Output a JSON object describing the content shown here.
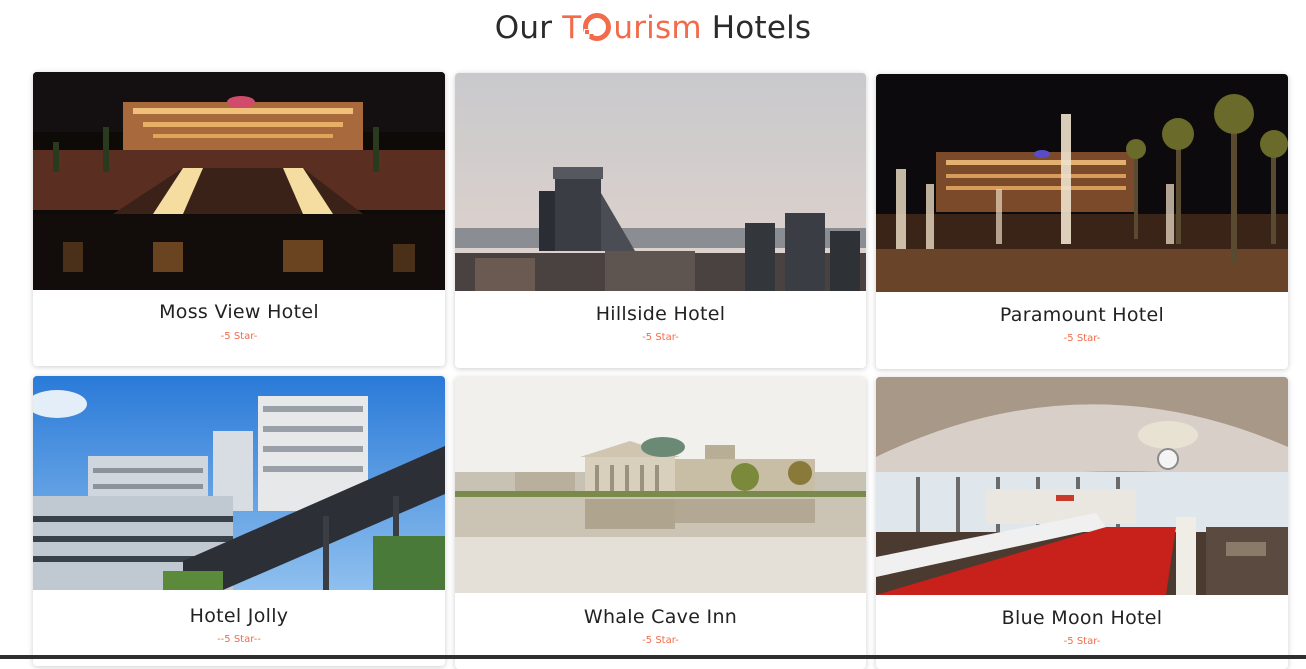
{
  "heading": {
    "prefix": "Our",
    "brand_t": "T",
    "brand_rest": "urism",
    "suffix": "Hotels"
  },
  "colors": {
    "accent": "#f26b4a",
    "text": "#222222"
  },
  "hotels": [
    {
      "name": "Moss View Hotel",
      "rating": "-5 Star-"
    },
    {
      "name": "Hillside Hotel",
      "rating": "-5 Star-"
    },
    {
      "name": "Paramount Hotel",
      "rating": "-5 Star-"
    },
    {
      "name": "Hotel Jolly",
      "rating": "--5 Star--"
    },
    {
      "name": "Whale Cave Inn",
      "rating": "-5 Star-"
    },
    {
      "name": "Blue Moon Hotel",
      "rating": "-5 Star-"
    }
  ]
}
